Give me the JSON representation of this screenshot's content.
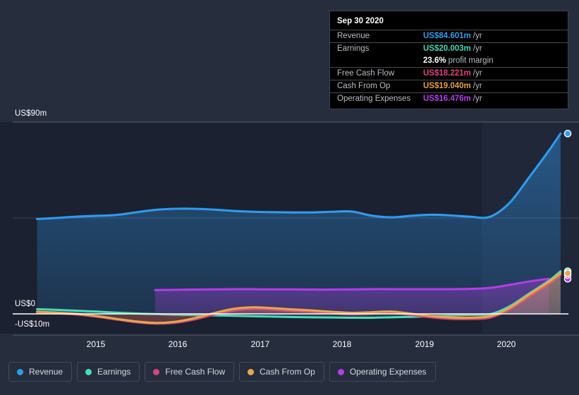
{
  "axis": {
    "y_labels": [
      {
        "text": "US$90m",
        "value": 90
      },
      {
        "text": "US$0",
        "value": 0
      },
      {
        "text": "-US$10m",
        "value": -10
      }
    ],
    "x_labels": [
      "2015",
      "2016",
      "2017",
      "2018",
      "2019",
      "2020"
    ]
  },
  "tooltip": {
    "date": "Sep 30 2020",
    "rows": [
      {
        "key": "Revenue",
        "value": "US$84.601m",
        "unit": "/yr",
        "color": "#2e9bf0"
      },
      {
        "key": "Earnings",
        "value": "US$20.003m",
        "unit": "/yr",
        "color": "#43d6b5"
      },
      {
        "key": "",
        "value": "23.6%",
        "unit": "profit margin",
        "color": "#ffffff"
      },
      {
        "key": "Free Cash Flow",
        "value": "US$18.221m",
        "unit": "/yr",
        "color": "#e0457f"
      },
      {
        "key": "Cash From Op",
        "value": "US$19.040m",
        "unit": "/yr",
        "color": "#e8a33c"
      },
      {
        "key": "Operating Expenses",
        "value": "US$16.476m",
        "unit": "/yr",
        "color": "#b93ceb"
      }
    ]
  },
  "legend": [
    {
      "label": "Revenue",
      "color": "#2e9bf0"
    },
    {
      "label": "Earnings",
      "color": "#47dcbb"
    },
    {
      "label": "Free Cash Flow",
      "color": "#d6457f"
    },
    {
      "label": "Cash From Op",
      "color": "#e8a84a"
    },
    {
      "label": "Operating Expenses",
      "color": "#b53ce8"
    }
  ],
  "chart_data": {
    "type": "area",
    "title": "",
    "xlabel": "",
    "ylabel": "US$m",
    "ylim": [
      -10,
      90
    ],
    "xlim": [
      2014.3,
      2021.1
    ],
    "grid": true,
    "legend_position": "bottom",
    "zero_line": 0,
    "forecast_start": 2020.0,
    "x": [
      2014.35,
      2014.6,
      2014.85,
      2015.1,
      2015.35,
      2015.6,
      2015.85,
      2016.1,
      2016.35,
      2016.6,
      2016.85,
      2017.1,
      2017.35,
      2017.6,
      2017.85,
      2018.1,
      2018.35,
      2018.6,
      2018.85,
      2019.1,
      2019.35,
      2019.6,
      2019.85,
      2020.1,
      2020.35,
      2020.6,
      2020.85,
      2021.0
    ],
    "series": [
      {
        "name": "Revenue",
        "color": "#2e9bf0",
        "values": [
          44.5,
          45.0,
          45.6,
          46.0,
          46.4,
          47.6,
          48.8,
          49.3,
          49.3,
          48.9,
          48.3,
          47.9,
          47.7,
          47.6,
          47.6,
          47.9,
          48.0,
          46.1,
          45.3,
          46.0,
          46.5,
          46.2,
          45.6,
          45.5,
          52.0,
          64.0,
          76.5,
          84.601
        ],
        "end_label": "US$84.601m"
      },
      {
        "name": "Earnings",
        "color": "#47dcbb",
        "values": [
          2.2,
          1.9,
          1.5,
          1.1,
          0.6,
          0.2,
          -0.1,
          -0.4,
          -0.6,
          -0.7,
          -0.9,
          -1.1,
          -1.3,
          -1.5,
          -1.6,
          -1.7,
          -1.8,
          -1.8,
          -1.6,
          -1.4,
          -1.1,
          -0.8,
          -0.5,
          -0.2,
          3.5,
          9.5,
          15.5,
          20.003
        ],
        "end_label": "US$20.003m"
      },
      {
        "name": "Free Cash Flow",
        "color": "#d6457f",
        "values": [
          0.5,
          0.2,
          -0.3,
          -1.3,
          -2.6,
          -3.9,
          -4.6,
          -4.2,
          -2.6,
          -0.3,
          1.6,
          2.3,
          2.0,
          1.4,
          0.9,
          0.3,
          -0.2,
          0.1,
          0.4,
          -0.5,
          -1.6,
          -2.3,
          -2.4,
          -1.8,
          2.0,
          8.0,
          14.0,
          18.221
        ],
        "end_label": "US$18.221m"
      },
      {
        "name": "Cash From Op",
        "color": "#e8a84a",
        "values": [
          1.0,
          0.6,
          0.0,
          -1.0,
          -2.3,
          -3.5,
          -4.2,
          -3.7,
          -2.0,
          0.4,
          2.4,
          3.1,
          2.7,
          2.1,
          1.6,
          1.0,
          0.5,
          0.8,
          1.1,
          0.1,
          -1.0,
          -1.7,
          -1.8,
          -1.1,
          2.8,
          9.0,
          15.0,
          19.04
        ],
        "end_label": "US$19.040m"
      },
      {
        "name": "Operating Expenses",
        "color": "#b53ce8",
        "start_x": 2015.75,
        "values_from": 2015.75,
        "values": [
          11.2,
          11.3,
          11.4,
          11.5,
          11.6,
          11.6,
          11.5,
          11.5,
          11.4,
          11.4,
          11.5,
          11.6,
          11.6,
          11.6,
          11.6,
          11.6,
          11.7,
          12.2,
          13.6,
          15.2,
          16.476
        ],
        "end_label": "US$16.476m"
      }
    ]
  }
}
